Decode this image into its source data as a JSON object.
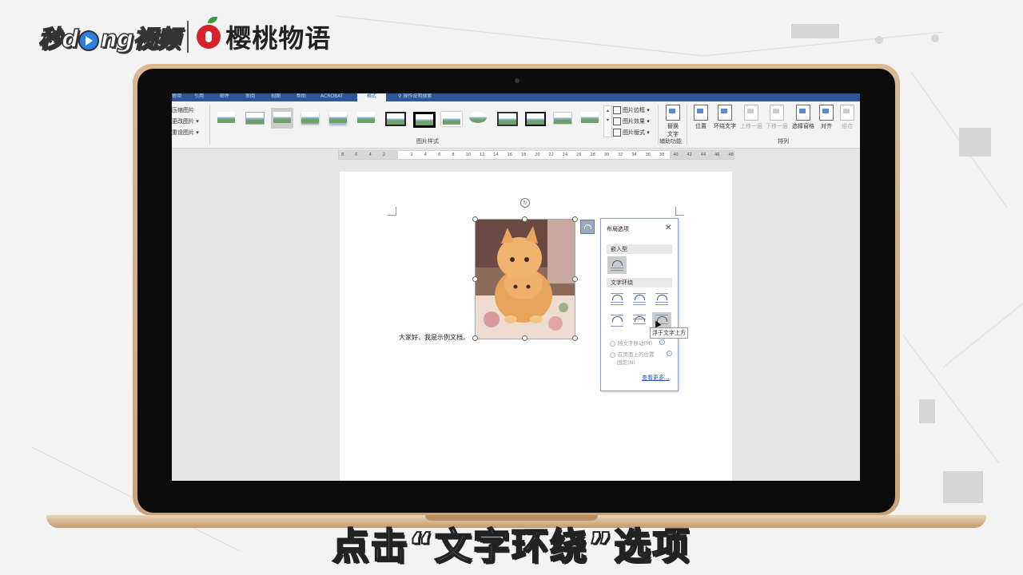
{
  "brand": {
    "left": "秒",
    "middle": "ng视频",
    "play_letter": "d",
    "right": "樱桃物语"
  },
  "ribbon": {
    "tabs": [
      "审阅",
      "引用",
      "邮件",
      "审阅",
      "视图",
      "帮助",
      "ACROBAT",
      "格式"
    ],
    "active_tab": "格式",
    "tell_me": "操作说明搜索",
    "left_commands": [
      "压缩图片",
      "更改图片 ▾",
      "重设图片 ▾"
    ],
    "gallery_label": "图片样式",
    "side_commands": [
      "图片边框 ▾",
      "图片效果 ▾",
      "图片版式 ▾"
    ],
    "alt_text": {
      "line1": "替换",
      "line2": "文字"
    },
    "accessibility_label": "辅助功能",
    "arrange": [
      "位置",
      "环绕文字",
      "上移一层",
      "下移一层",
      "选择窗格",
      "对齐",
      "组合"
    ],
    "arrange_label": "排列"
  },
  "ruler": [
    "8",
    "6",
    "4",
    "2",
    "",
    "2",
    "4",
    "6",
    "8",
    "10",
    "12",
    "14",
    "16",
    "18",
    "20",
    "22",
    "24",
    "26",
    "28",
    "30",
    "32",
    "34",
    "36",
    "38",
    "40",
    "42",
    "44",
    "46",
    "48"
  ],
  "document": {
    "text": "大家好，我是示例文档。"
  },
  "layout_panel": {
    "title": "布局选项",
    "close": "✕",
    "inline_section": "嵌入型",
    "wrap_section": "文字环绕",
    "move_with_text": "随文字移动(M)",
    "fix_position": "在页面上的位置",
    "fix_position_2": "固定(N)",
    "see_more": "查看更多..."
  },
  "tooltip": "浮于文字上方",
  "caption": "点击“文字环绕”选项"
}
